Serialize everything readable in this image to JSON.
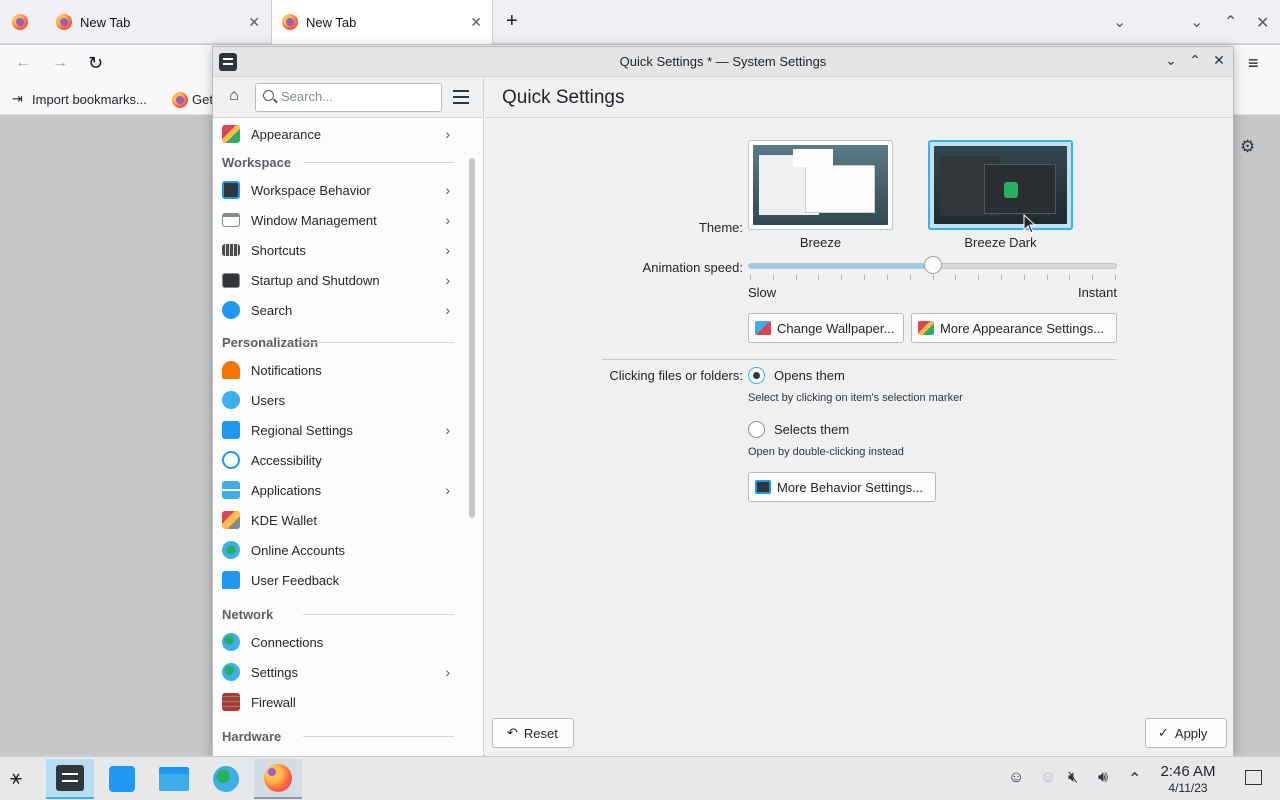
{
  "firefox": {
    "tabs": [
      {
        "label": "New Tab"
      },
      {
        "label": "New Tab"
      }
    ],
    "new_tab_symbol": "+",
    "bookmarks": {
      "import_label": "Import bookmarks...",
      "get_label": "Get"
    }
  },
  "window": {
    "title": "Quick Settings * — System Settings"
  },
  "sidebar": {
    "search_placeholder": "Search...",
    "top_items": [
      {
        "label": "Appearance",
        "icon": "appearance-icon",
        "has_children": true
      }
    ],
    "categories": [
      {
        "title": "Workspace",
        "items": [
          {
            "label": "Workspace Behavior",
            "icon": "workspace-behavior-icon",
            "has_children": true
          },
          {
            "label": "Window Management",
            "icon": "window-management-icon",
            "has_children": true
          },
          {
            "label": "Shortcuts",
            "icon": "keyboard-icon",
            "has_children": true
          },
          {
            "label": "Startup and Shutdown",
            "icon": "startup-icon",
            "has_children": true
          },
          {
            "label": "Search",
            "icon": "search-icon",
            "has_children": true
          }
        ]
      },
      {
        "title": "Personalization",
        "items": [
          {
            "label": "Notifications",
            "icon": "bell-icon",
            "has_children": false
          },
          {
            "label": "Users",
            "icon": "users-icon",
            "has_children": false
          },
          {
            "label": "Regional Settings",
            "icon": "regional-icon",
            "has_children": true
          },
          {
            "label": "Accessibility",
            "icon": "accessibility-icon",
            "has_children": false
          },
          {
            "label": "Applications",
            "icon": "applications-icon",
            "has_children": true
          },
          {
            "label": "KDE Wallet",
            "icon": "wallet-icon",
            "has_children": false
          },
          {
            "label": "Online Accounts",
            "icon": "online-accounts-icon",
            "has_children": false
          },
          {
            "label": "User Feedback",
            "icon": "feedback-icon",
            "has_children": false
          }
        ]
      },
      {
        "title": "Network",
        "items": [
          {
            "label": "Connections",
            "icon": "globe-icon",
            "has_children": false
          },
          {
            "label": "Settings",
            "icon": "globe-icon",
            "has_children": true
          },
          {
            "label": "Firewall",
            "icon": "firewall-icon",
            "has_children": false
          }
        ]
      },
      {
        "title": "Hardware",
        "items": []
      }
    ]
  },
  "main": {
    "title": "Quick Settings",
    "theme_label": "Theme:",
    "themes": [
      {
        "name": "Breeze",
        "selected": false
      },
      {
        "name": "Breeze Dark",
        "selected": true
      }
    ],
    "animation_label": "Animation speed:",
    "animation_value": 0.5,
    "animation_min_label": "Slow",
    "animation_max_label": "Instant",
    "change_wallpaper_label": "Change Wallpaper...",
    "more_appearance_label": "More Appearance Settings...",
    "clicking_label": "Clicking files or folders:",
    "options": [
      {
        "label": "Opens them",
        "hint": "Select by clicking on item's selection marker",
        "checked": true
      },
      {
        "label": "Selects them",
        "hint": "Open by double-clicking instead",
        "checked": false
      }
    ],
    "more_behavior_label": "More Behavior Settings...",
    "reset_label": "Reset",
    "apply_label": "Apply"
  },
  "taskbar": {
    "time": "2:46 AM",
    "date": "4/11/23",
    "accent": "#3daee9"
  }
}
